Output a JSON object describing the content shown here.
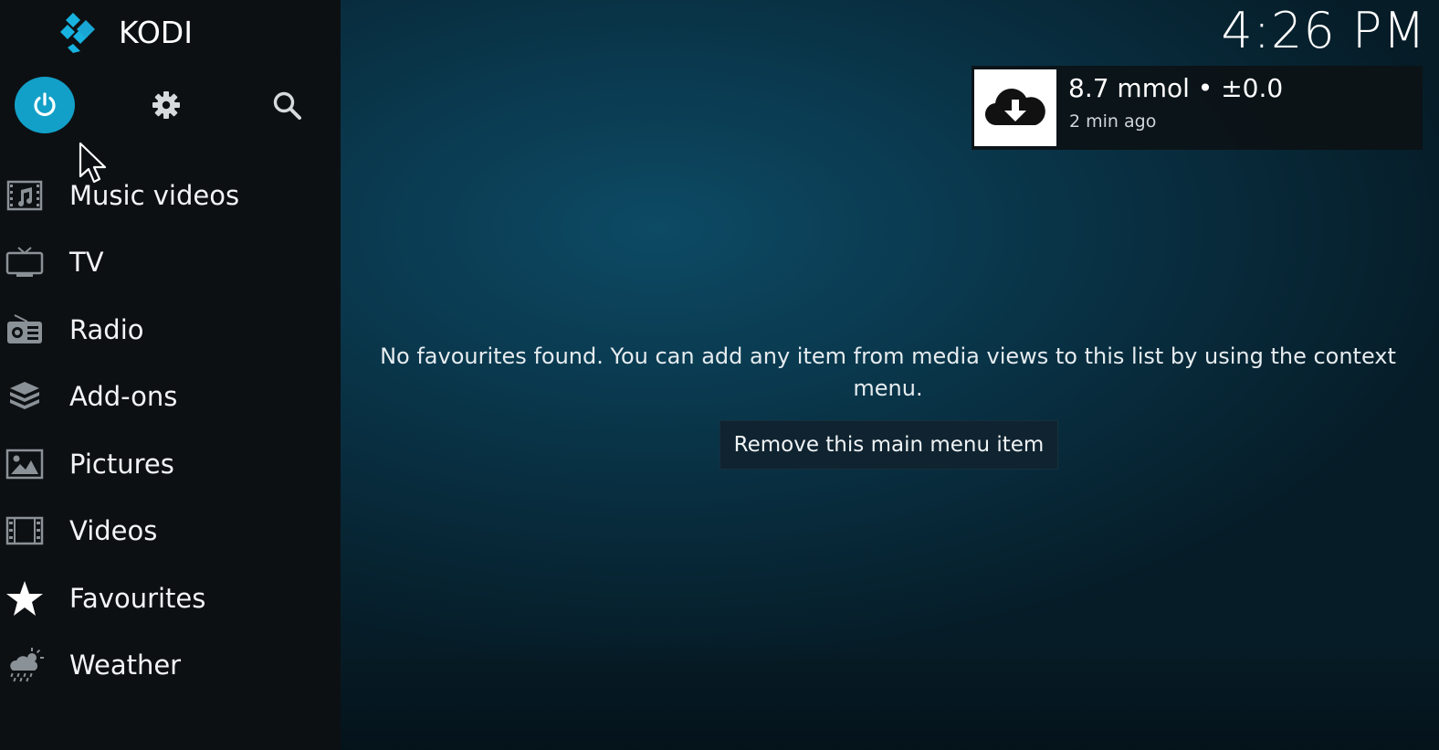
{
  "app": {
    "title": "KODI"
  },
  "clock": {
    "time": "4:26 PM"
  },
  "top_buttons": [
    {
      "name": "power",
      "icon": "power-icon"
    },
    {
      "name": "settings",
      "icon": "gear-icon"
    },
    {
      "name": "search",
      "icon": "search-icon"
    }
  ],
  "sidebar": {
    "items": [
      {
        "label": "Music videos",
        "icon": "music-video-icon"
      },
      {
        "label": "TV",
        "icon": "tv-icon"
      },
      {
        "label": "Radio",
        "icon": "radio-icon"
      },
      {
        "label": "Add-ons",
        "icon": "addons-box-icon"
      },
      {
        "label": "Pictures",
        "icon": "picture-icon"
      },
      {
        "label": "Videos",
        "icon": "film-icon"
      },
      {
        "label": "Favourites",
        "icon": "star-icon"
      },
      {
        "label": "Weather",
        "icon": "weather-icon"
      }
    ]
  },
  "notification": {
    "title": "8.7 mmol • ±0.0",
    "subtitle": "2 min ago",
    "icon": "cloud-download-icon"
  },
  "main": {
    "empty_message": "No favourites found. You can add any item from media views to this list by using the context menu.",
    "remove_button_label": "Remove this main menu item"
  },
  "colors": {
    "accent": "#12a0c8",
    "sidebar_bg": "#0d1013",
    "background": "#0a3a50"
  }
}
